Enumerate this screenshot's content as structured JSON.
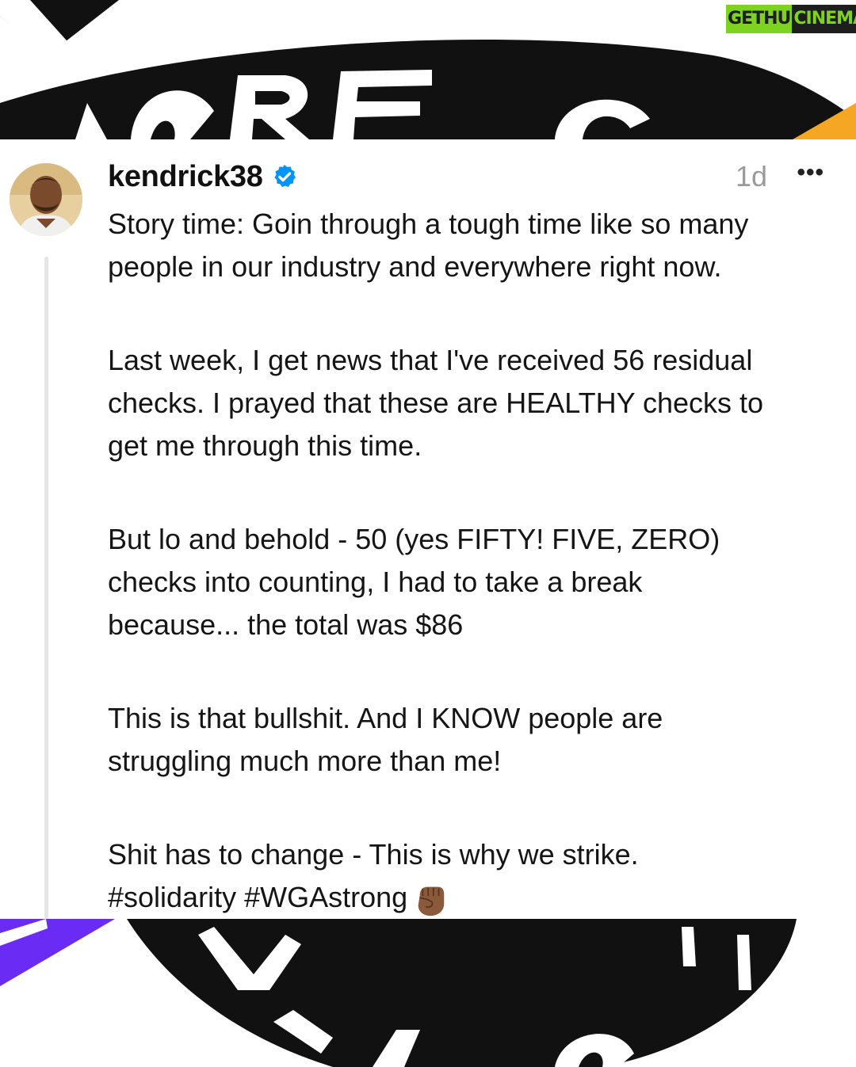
{
  "watermark": {
    "part1": "GETHU",
    "part2": "CINEMA"
  },
  "background_text": {
    "top": "MORE S",
    "bottom_left": "N",
    "bottom_right": "ISC"
  },
  "post": {
    "username": "kendrick38",
    "verified": true,
    "timestamp": "1d",
    "more_label": "•••",
    "paragraphs": [
      "Story time:  Goin through a tough time like so many\npeople in our industry and everywhere right now.",
      "Last week, I get news that I've received 56 residual\nchecks.  I prayed that these are HEALTHY checks to\nget me through this time.",
      "But lo and behold - 50 (yes FIFTY! FIVE, ZERO)\nchecks into counting, I had to take a break\nbecause... the total was $86",
      "This is that bullshit.  And I KNOW people are\nstruggling much more than me!",
      "Shit has to change - This is why we strike.\n#solidarity #WGAstrong"
    ],
    "emoji": "raised-fist-medium-dark",
    "icons": {
      "avatar": "avatar",
      "verified": "verified-badge-icon",
      "more": "more-options-icon"
    }
  },
  "colors": {
    "verified": "#0095f6",
    "band_black": "#111111",
    "accent_purple": "#6a2cf5",
    "accent_orange": "#f5a623",
    "watermark_green": "#7ed321"
  }
}
